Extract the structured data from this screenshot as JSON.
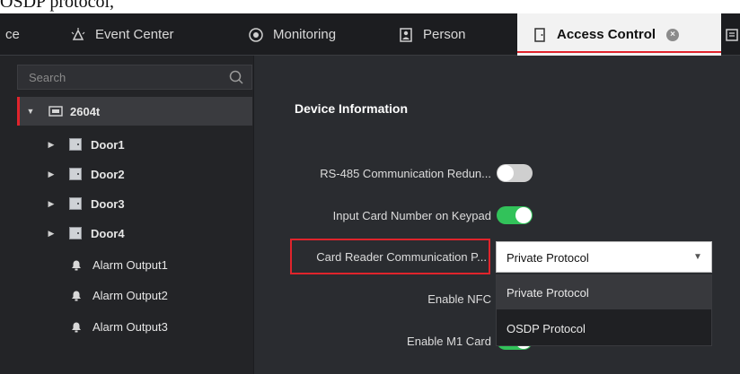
{
  "doc_text": "OSDP protocol,",
  "tabs": [
    {
      "label": "ce"
    },
    {
      "label": "Event Center"
    },
    {
      "label": "Monitoring"
    },
    {
      "label": "Person"
    },
    {
      "label": "Access Control",
      "active": true
    }
  ],
  "sidebar": {
    "search_placeholder": "Search",
    "root": "2604t",
    "items": [
      {
        "label": "Door1"
      },
      {
        "label": "Door2"
      },
      {
        "label": "Door3"
      },
      {
        "label": "Door4"
      },
      {
        "label": "Alarm Output1"
      },
      {
        "label": "Alarm Output2"
      },
      {
        "label": "Alarm Output3"
      }
    ]
  },
  "panel": {
    "title": "Device Information",
    "settings": [
      {
        "label": "RS-485 Communication Redun...",
        "value": false
      },
      {
        "label": "Input Card Number on Keypad",
        "value": true
      },
      {
        "label": "Card Reader Communication P...",
        "selected": "Private Protocol"
      },
      {
        "label": "Enable NFC"
      },
      {
        "label": "Enable M1 Card",
        "value": true
      }
    ],
    "dropdown_options": [
      "Private Protocol",
      "OSDP Protocol"
    ]
  },
  "colors": {
    "accent": "#e0242c",
    "toggle_on": "#32c25a",
    "toggle_off": "#cfcfcf"
  }
}
